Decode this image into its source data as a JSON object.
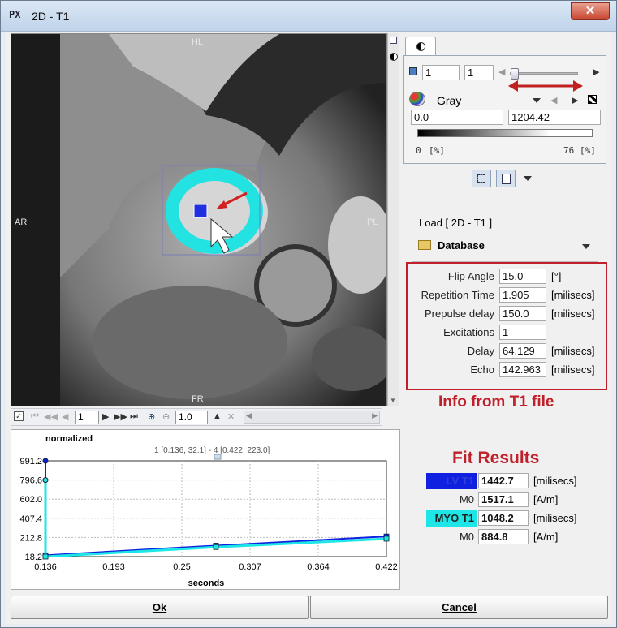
{
  "window": {
    "title": "2D - T1",
    "close_label": "✕",
    "app_icon": "PX"
  },
  "image": {
    "labels": {
      "top": "HL",
      "left": "AR",
      "right": "PL",
      "bottom": "FR"
    }
  },
  "toolbar": {
    "frame_value": "1",
    "zoom_value": "1.0"
  },
  "viewer_panel": {
    "tab_icon": "contrast-icon",
    "slice_a": "1",
    "slice_b": "1",
    "colormap": "Gray",
    "min_value": "0.0",
    "max_value": "1204.42",
    "lower_pct": "0",
    "upper_pct": "76",
    "pct_unit": "[%]"
  },
  "load": {
    "title": "Load [ 2D - T1 ]",
    "source": "Database"
  },
  "params": [
    {
      "label": "Flip Angle",
      "value": "15.0",
      "unit": "[°]"
    },
    {
      "label": "Repetition Time",
      "value": "1.905",
      "unit": "[milisecs]"
    },
    {
      "label": "Prepulse delay",
      "value": "150.0",
      "unit": "[milisecs]"
    },
    {
      "label": "Excitations",
      "value": "1",
      "unit": ""
    },
    {
      "label": "Delay",
      "value": "64.129",
      "unit": "[milisecs]"
    },
    {
      "label": "Echo",
      "value": "142.963",
      "unit": "[milisecs]"
    }
  ],
  "info_caption": "Info from T1 file",
  "fit": {
    "title": "Fit Results",
    "rows": [
      {
        "label": "LV T1",
        "value": "1442.7",
        "unit": "[milisecs]",
        "color": "#1020e0"
      },
      {
        "label": "M0",
        "value": "1517.1",
        "unit": "[A/m]",
        "color": ""
      },
      {
        "label": "MYO T1",
        "value": "1048.2",
        "unit": "[milisecs]",
        "color": "#1ee6e6"
      },
      {
        "label": "M0",
        "value": "884.8",
        "unit": "[A/m]",
        "color": ""
      }
    ]
  },
  "chart_data": {
    "type": "line",
    "title": "normalized",
    "subtitle": "1 [0.136, 32.1] - 4 [0.422, 223.0]",
    "xlabel": "seconds",
    "ylabel": "",
    "x_ticks": [
      "0.136",
      "0.193",
      "0.25",
      "0.307",
      "0.364",
      "0.422"
    ],
    "y_ticks": [
      "18.2",
      "212.8",
      "407.4",
      "602.0",
      "796.6",
      "991.2"
    ],
    "xlim": [
      0.136,
      0.422
    ],
    "ylim": [
      18.2,
      991.2
    ],
    "series": [
      {
        "color": "#1020e0",
        "x": [
          0.136,
          0.136,
          0.279,
          0.422
        ],
        "y": [
          991.2,
          32.1,
          130.0,
          223.0
        ]
      },
      {
        "color": "#1ee6e6",
        "x": [
          0.136,
          0.136,
          0.279,
          0.422
        ],
        "y": [
          796.6,
          18.2,
          115.0,
          200.0
        ]
      }
    ]
  },
  "buttons": {
    "ok": "Ok",
    "cancel": "Cancel"
  }
}
